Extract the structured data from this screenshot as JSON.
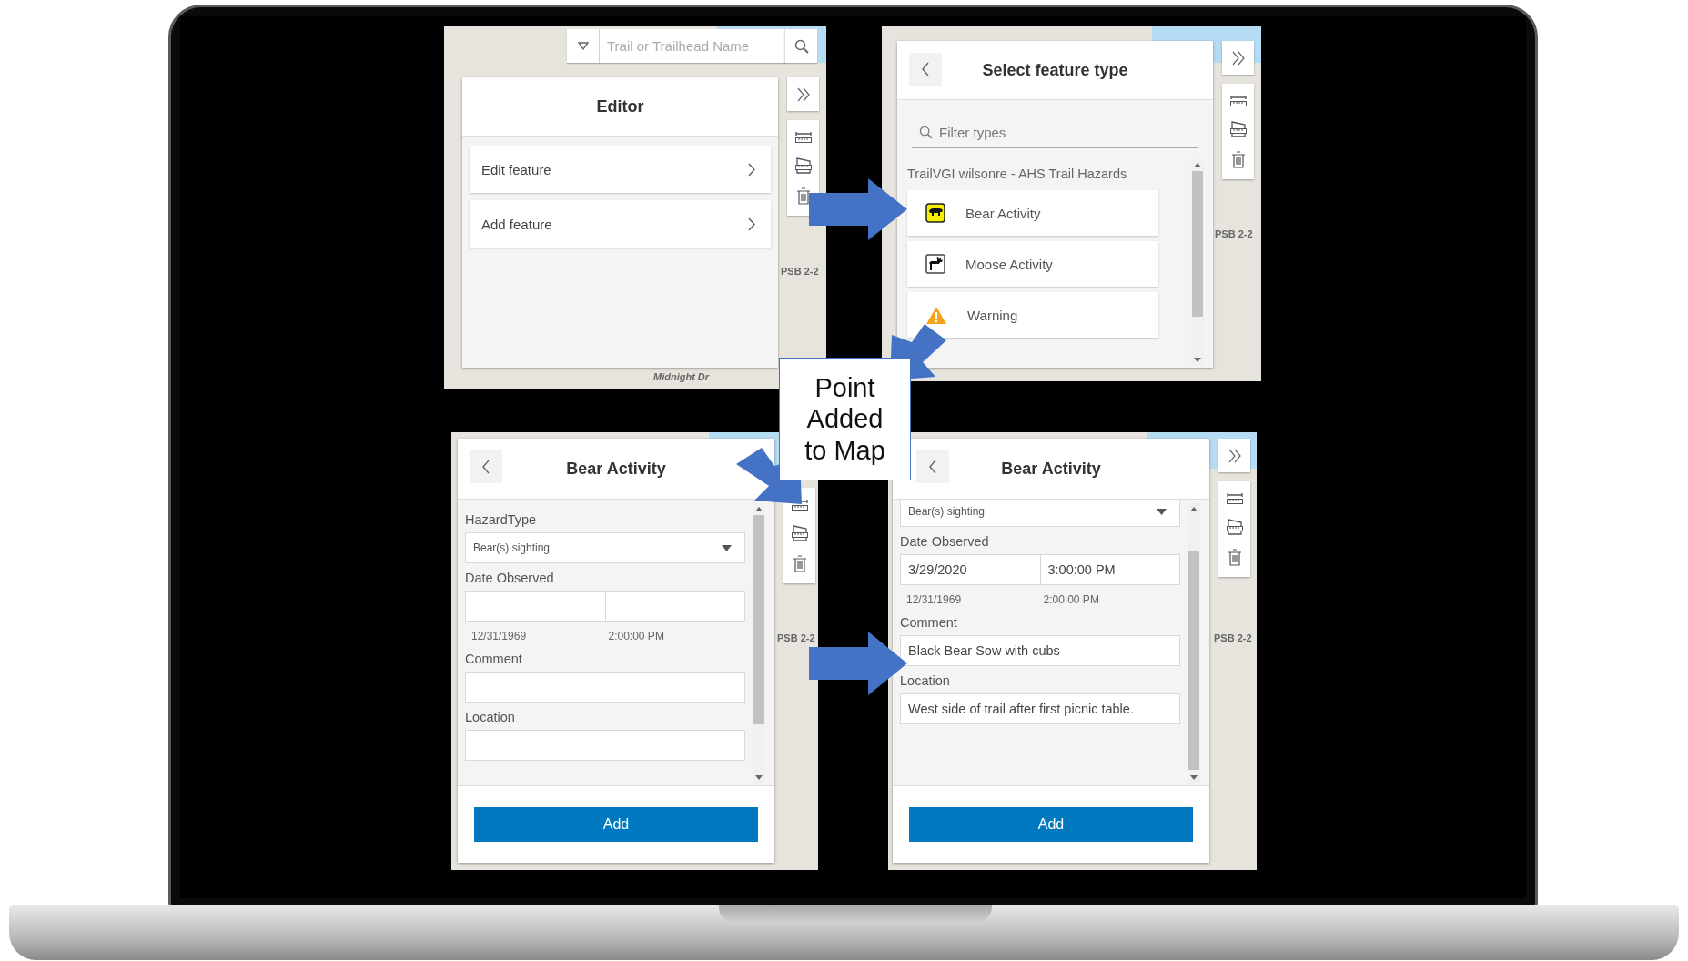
{
  "panels": [
    {
      "kind": "editor",
      "search": {
        "placeholder": "Trail or Trailhead Name"
      },
      "title": "Editor",
      "items": [
        {
          "label": "Edit feature"
        },
        {
          "label": "Add feature"
        }
      ],
      "map_labels": [
        "PSB 2-2",
        "Midnight Dr"
      ],
      "collapse": true
    },
    {
      "kind": "types",
      "title": "Select feature type",
      "filter": {
        "placeholder": "Filter types"
      },
      "group": "TrailVGI wilsonre - AHS Trail Hazards",
      "types": [
        {
          "kind": "bear",
          "label": "Bear Activity"
        },
        {
          "kind": "moose",
          "label": "Moose Activity"
        },
        {
          "kind": "warning",
          "label": "Warning"
        }
      ],
      "map_labels": [
        "PSB 2-2"
      ],
      "collapse": true
    },
    {
      "kind": "form",
      "title": "Bear Activity",
      "fields": [
        {
          "kind": "select",
          "label": "HazardType",
          "value": "Bear(s) sighting"
        },
        {
          "kind": "datetime",
          "label": "Date Observed",
          "hints": [
            "12/31/1969",
            "2:00:00 PM"
          ]
        },
        {
          "kind": "text",
          "label": "Comment"
        },
        {
          "kind": "text",
          "label": "Location"
        }
      ],
      "button": "Add",
      "map_labels": [
        "PSB 2-2"
      ],
      "collapse": false
    },
    {
      "kind": "form",
      "title": "Bear Activity",
      "fields": [
        {
          "kind": "select",
          "value": "Bear(s) sighting"
        },
        {
          "kind": "datetime",
          "label": "Date Observed",
          "date": "3/29/2020",
          "time": "3:00:00 PM",
          "hints": [
            "12/31/1969",
            "2:00:00 PM"
          ]
        },
        {
          "kind": "text",
          "label": "Comment",
          "value": "Black Bear Sow with cubs"
        },
        {
          "kind": "text",
          "label": "Location",
          "value": "West side of trail after first picnic table."
        }
      ],
      "button": "Add",
      "map_labels": [
        "PSB 2-2"
      ],
      "collapse": true
    }
  ],
  "callout": {
    "lines": [
      "Point",
      "Added",
      "to Map"
    ]
  }
}
